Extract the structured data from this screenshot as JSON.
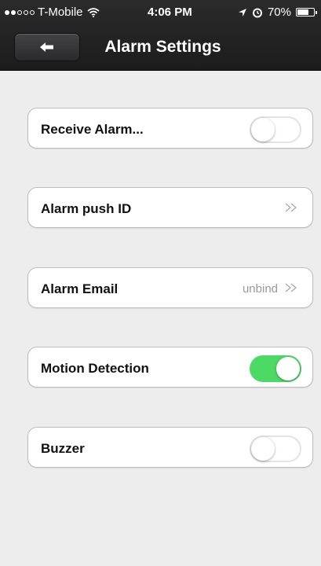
{
  "status_bar": {
    "carrier": "T-Mobile",
    "time": "4:06 PM",
    "battery": "70%",
    "battery_level": 0.7,
    "icons": [
      "signal-dots",
      "wifi-icon",
      "location-icon",
      "alarm-icon",
      "battery-icon"
    ]
  },
  "header": {
    "back_icon": "back-arrow-icon",
    "title": "Alarm Settings"
  },
  "settings": {
    "receive_alarm": {
      "label": "Receive Alarm...",
      "enabled": false
    },
    "alarm_push_id": {
      "label": "Alarm push ID",
      "icon": "chevron-double-icon"
    },
    "alarm_email": {
      "label": "Alarm Email",
      "value": "unbind",
      "icon": "chevron-double-icon"
    },
    "motion_detection": {
      "label": "Motion Detection",
      "enabled": true
    },
    "buzzer": {
      "label": "Buzzer",
      "enabled": false
    }
  },
  "colors": {
    "toggle_on": "#4cd964",
    "header_background": "#1f1f20",
    "page_background": "#ededee"
  }
}
